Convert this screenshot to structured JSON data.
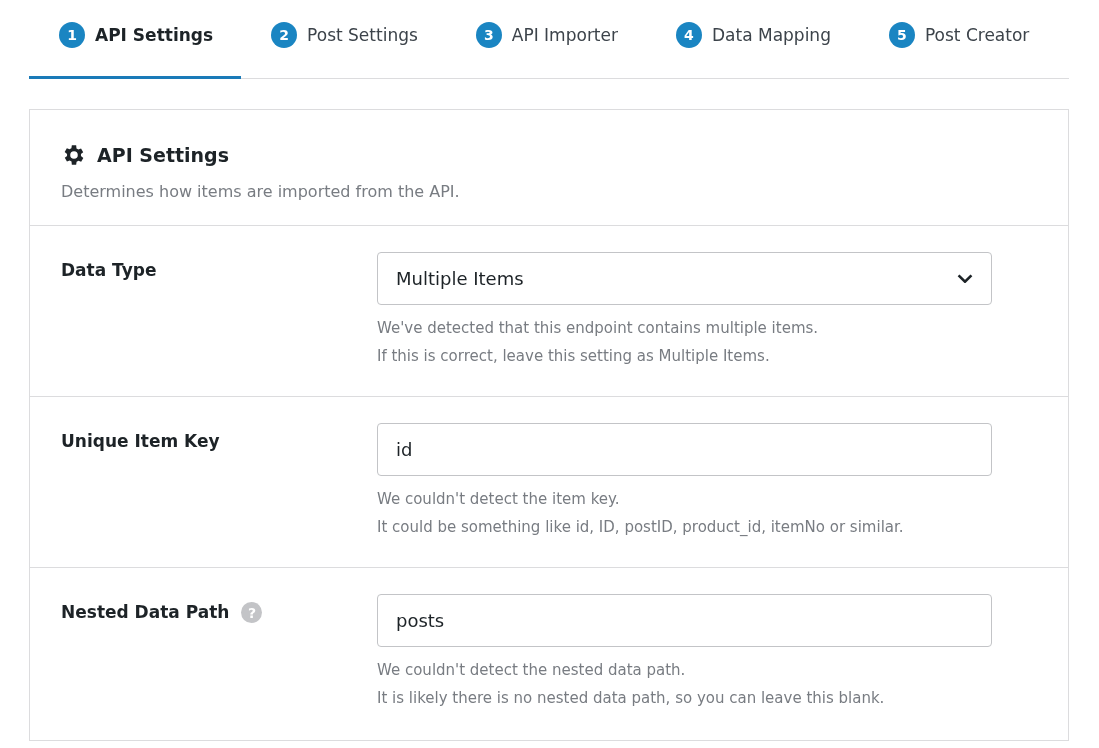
{
  "tabs": [
    {
      "number": "1",
      "label": "API Settings",
      "selected": true
    },
    {
      "number": "2",
      "label": "Post Settings",
      "selected": false
    },
    {
      "number": "3",
      "label": "API Importer",
      "selected": false
    },
    {
      "number": "4",
      "label": "Data Mapping",
      "selected": false
    },
    {
      "number": "5",
      "label": "Post Creator",
      "selected": false
    }
  ],
  "panel": {
    "title": "API Settings",
    "description": "Determines how items are imported from the API."
  },
  "fields": [
    {
      "kind": "select",
      "label": "Data Type",
      "value": "Multiple Items",
      "notes": [
        "We've detected that this endpoint contains multiple items.",
        "If this is correct, leave this setting as Multiple Items."
      ]
    },
    {
      "kind": "input",
      "label": "Unique Item Key",
      "value": "id",
      "notes": [
        "We couldn't detect the item key.",
        "It could be something like id, ID, postID, product_id, itemNo or similar."
      ]
    },
    {
      "kind": "input",
      "label": "Nested Data Path",
      "help": "?",
      "value": "posts",
      "notes": [
        "We couldn't detect the nested data path.",
        "It is likely there is no nested data path, so you can leave this blank."
      ]
    }
  ]
}
